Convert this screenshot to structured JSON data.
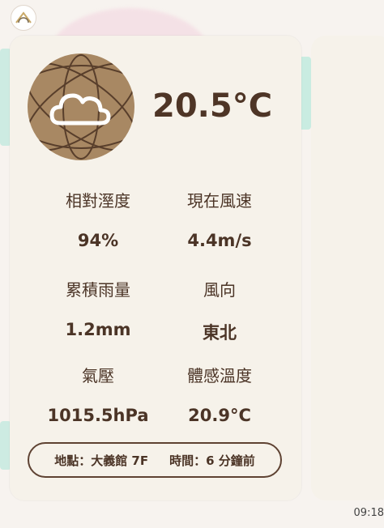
{
  "weather": {
    "temperature": "20.5°C",
    "icon": "cloud-icon"
  },
  "stats": {
    "humidity_label": "相對溼度",
    "humidity_value": "94%",
    "wind_speed_label": "現在風速",
    "wind_speed_value": "4.4m/s",
    "rainfall_label": "累積雨量",
    "rainfall_value": "1.2mm",
    "wind_dir_label": "風向",
    "wind_dir_value": "東北",
    "pressure_label": "氣壓",
    "pressure_value": "1015.5hPa",
    "feels_label": "體感溫度",
    "feels_value": "20.9°C"
  },
  "footer": {
    "location": "地點：大義館 7F",
    "time": "時間：6 分鐘前"
  },
  "clock": "09:18",
  "colors": {
    "card": "#f6f2ea",
    "icon_bg": "#a88863",
    "text": "#4b3426"
  }
}
